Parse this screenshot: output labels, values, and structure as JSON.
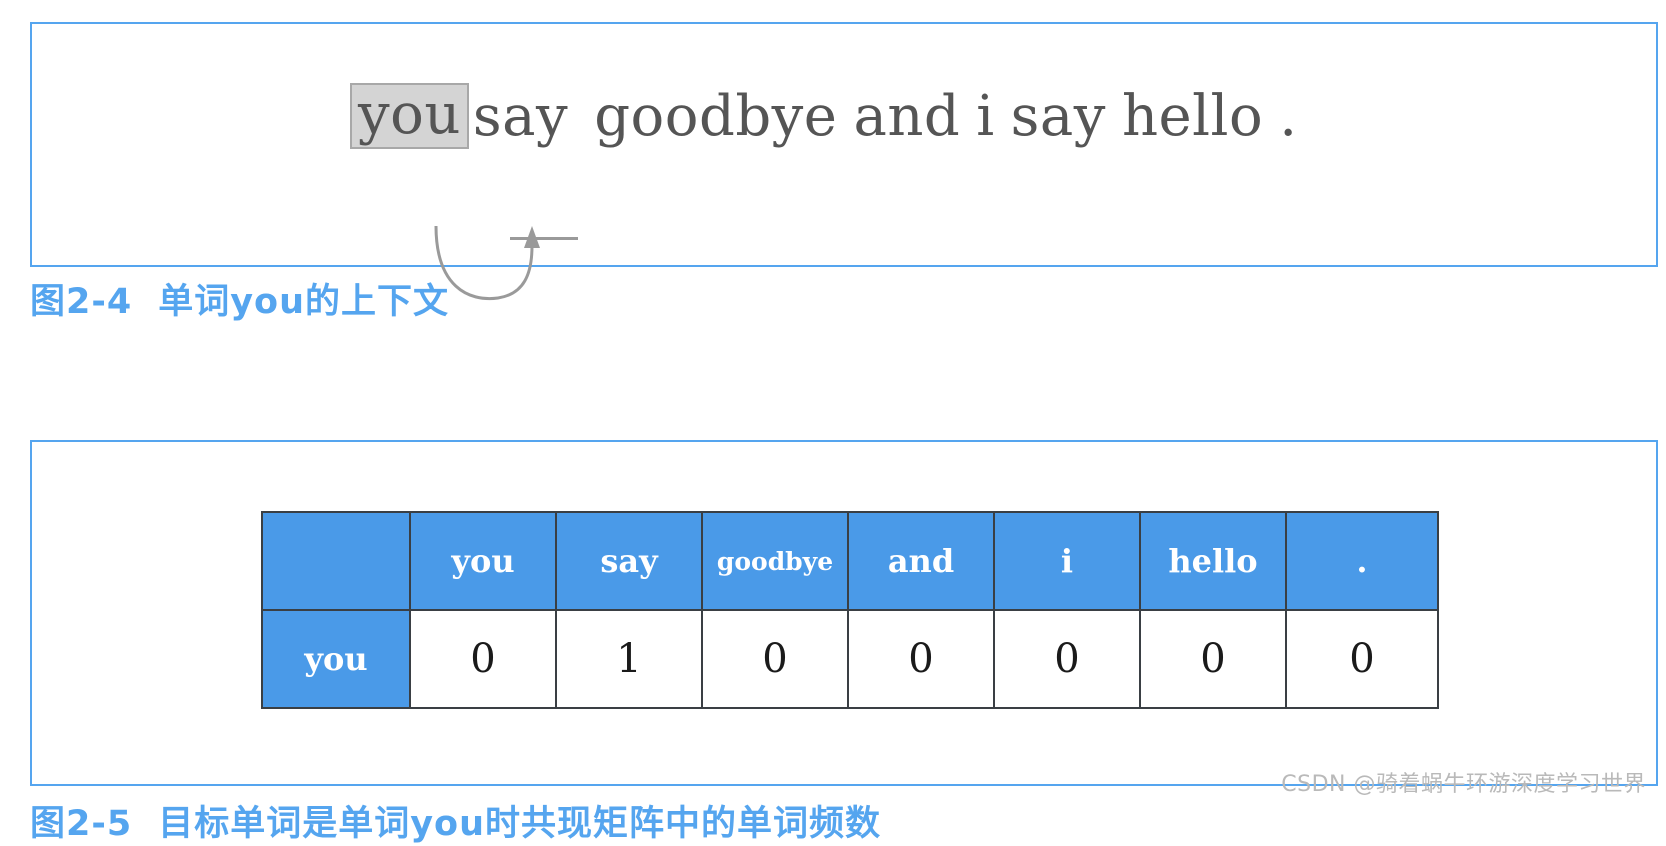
{
  "figure_1": {
    "sentence_tokens": [
      "you",
      "say",
      "goodbye",
      "and",
      "i",
      "say",
      "hello",
      "."
    ],
    "highlighted_token": "you",
    "underlined_token": "say",
    "token_you": "you",
    "token_say": "say",
    "token_goodbye": "goodbye",
    "token_and": "and",
    "token_i": "i",
    "token_say2": "say",
    "token_hello": "hello",
    "token_period": ".",
    "highlight_bg": "#d4d4d4",
    "highlight_border": "#a8a8a8",
    "text_color": "#555555",
    "arrow_color": "#9a9a9a"
  },
  "caption_1": {
    "number": "图2-4",
    "text": "单词you的上下文",
    "color": "#55a5ef"
  },
  "caption_2": {
    "number": "图2-5",
    "text": "目标单词是单词you时共现矩阵中的单词频数",
    "color": "#55a5ef"
  },
  "figure_2": {
    "table": {
      "corner_label": "",
      "column_headers": [
        "you",
        "say",
        "goodbye",
        "and",
        "i",
        "hello",
        "."
      ],
      "rows": [
        {
          "label": "you",
          "values": [
            "0",
            "1",
            "0",
            "0",
            "0",
            "0",
            "0"
          ]
        }
      ],
      "header_bg": "#4a9ae8",
      "header_text_color": "#ffffff",
      "cell_bg": "#ffffff",
      "cell_text_color": "#1a1a1a",
      "border_color": "#3a3f44"
    }
  },
  "watermark": {
    "text": "CSDN @骑着蜗牛环游深度学习世界",
    "color": "#b9b9b9"
  },
  "theme": {
    "box_border": "#55a5ef",
    "page_bg": "#ffffff"
  }
}
